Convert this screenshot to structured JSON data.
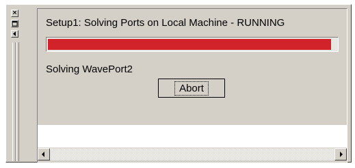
{
  "window": {
    "title": "Setup1: Solving Ports on Local Machine - RUNNING",
    "progress_percent": 98,
    "progress_color": "#d2232a",
    "status": "Solving WavePort2",
    "abort_label": "Abort"
  },
  "grip": {
    "close_icon": "close-icon",
    "maximize_icon": "maximize-icon",
    "collapse_icon": "chevron-left-icon"
  },
  "scrollbar": {
    "left_icon": "arrow-left-icon",
    "right_icon": "arrow-right-icon"
  }
}
